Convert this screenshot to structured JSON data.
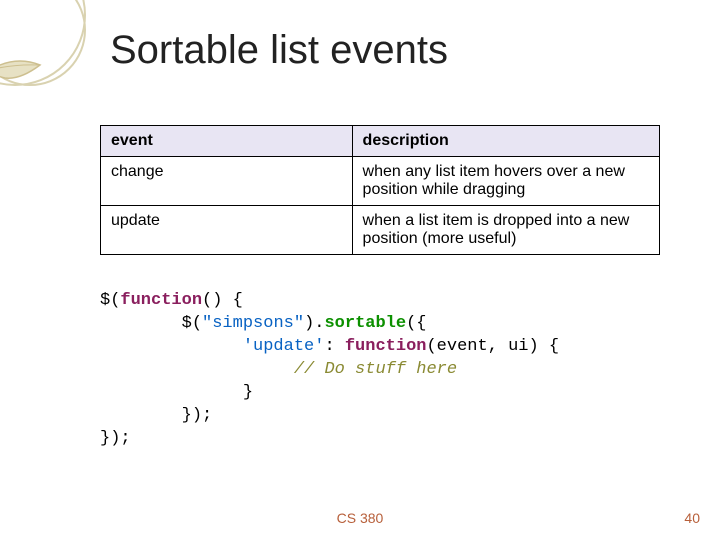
{
  "title": "Sortable list events",
  "table": {
    "headers": {
      "event": "event",
      "description": "description"
    },
    "rows": [
      {
        "event": "change",
        "description": "when any list item hovers over a new position while dragging"
      },
      {
        "event": "update",
        "description": "when a list item is dropped into a new position (more useful)"
      }
    ]
  },
  "code": {
    "line1_a": "$(",
    "line1_fn": "function",
    "line1_b": "() {",
    "line2_a": "        $(",
    "line2_sel": "\"simpsons\"",
    "line2_b": ").",
    "line2_call": "sortable",
    "line2_c": "({",
    "line3_a": "              ",
    "line3_key": "'update'",
    "line3_b": ": ",
    "line3_fn": "function",
    "line3_c": "(event, ui) {",
    "line4_a": "                   ",
    "line4_comment": "// Do stuff here",
    "line5": "              }",
    "line6": "        });",
    "line7": "});"
  },
  "footer": {
    "course": "CS 380",
    "page": "40"
  },
  "decor": {
    "name": "leaf-corner-ornament"
  }
}
